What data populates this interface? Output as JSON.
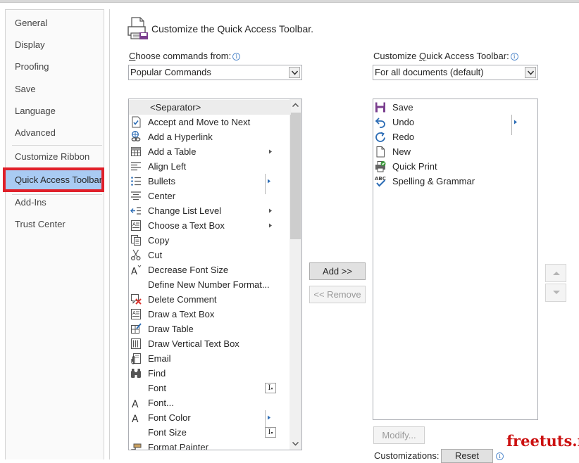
{
  "sidebar": {
    "items": [
      {
        "label": "General",
        "selected": false
      },
      {
        "label": "Display",
        "selected": false
      },
      {
        "label": "Proofing",
        "selected": false
      },
      {
        "label": "Save",
        "selected": false
      },
      {
        "label": "Language",
        "selected": false
      },
      {
        "label": "Advanced",
        "selected": false
      },
      {
        "label": "Customize Ribbon",
        "selected": false
      },
      {
        "label": "Quick Access Toolbar",
        "selected": true
      },
      {
        "label": "Add-Ins",
        "selected": false
      },
      {
        "label": "Trust Center",
        "selected": false
      }
    ]
  },
  "header": {
    "title": "Customize the Quick Access Toolbar.",
    "icon": "toolbar-printer-icon"
  },
  "choose": {
    "label": "Choose commands from:",
    "label_underline": "C",
    "label_rest": "hoose commands from:",
    "value": "Popular Commands"
  },
  "customize": {
    "label_pre": "Customize ",
    "label_underline": "Q",
    "label_post": "uick Access Toolbar:",
    "value": "For all documents (default)"
  },
  "commands": [
    {
      "label": "<Separator>",
      "icon": "separator",
      "separator": true
    },
    {
      "label": "Accept and Move to Next",
      "icon": "accept-icon"
    },
    {
      "label": "Add a Hyperlink",
      "icon": "hyperlink-icon"
    },
    {
      "label": "Add a Table",
      "icon": "table-icon",
      "submenu": "arrow"
    },
    {
      "label": "Align Left",
      "icon": "align-left-icon"
    },
    {
      "label": "Bullets",
      "icon": "bullets-icon",
      "submenu": "bar-arrow"
    },
    {
      "label": "Center",
      "icon": "center-icon"
    },
    {
      "label": "Change List Level",
      "icon": "list-level-icon",
      "submenu": "arrow"
    },
    {
      "label": "Choose a Text Box",
      "icon": "textbox-icon",
      "submenu": "arrow"
    },
    {
      "label": "Copy",
      "icon": "copy-icon"
    },
    {
      "label": "Cut",
      "icon": "scissors-icon"
    },
    {
      "label": "Decrease Font Size",
      "icon": "decrease-font-icon"
    },
    {
      "label": "Define New Number Format...",
      "icon": ""
    },
    {
      "label": "Delete Comment",
      "icon": "delete-comment-icon"
    },
    {
      "label": "Draw a Text Box",
      "icon": "draw-textbox-icon"
    },
    {
      "label": "Draw Table",
      "icon": "draw-table-icon"
    },
    {
      "label": "Draw Vertical Text Box",
      "icon": "vertical-textbox-icon"
    },
    {
      "label": "Email",
      "icon": "email-icon"
    },
    {
      "label": "Find",
      "icon": "binoculars-icon"
    },
    {
      "label": "Font",
      "icon": "",
      "submenu": "ibox"
    },
    {
      "label": "Font...",
      "icon": "font-a-icon"
    },
    {
      "label": "Font Color",
      "icon": "font-color-icon",
      "submenu": "bar-arrow"
    },
    {
      "label": "Font Size",
      "icon": "",
      "submenu": "ibox"
    },
    {
      "label": "Format Painter",
      "icon": "format-painter-icon"
    }
  ],
  "toolbar_items": [
    {
      "label": "Save",
      "icon": "save-icon"
    },
    {
      "label": "Undo",
      "icon": "undo-icon",
      "submenu": "bar-arrow"
    },
    {
      "label": "Redo",
      "icon": "redo-icon"
    },
    {
      "label": "New",
      "icon": "new-doc-icon"
    },
    {
      "label": "Quick Print",
      "icon": "quick-print-icon"
    },
    {
      "label": "Spelling & Grammar",
      "icon": "spelling-icon"
    }
  ],
  "buttons": {
    "add": "Add >>",
    "remove": "<< Remove",
    "modify": "Modify...",
    "customizations": "Customizations:",
    "reset": "Reset"
  },
  "watermark": "freetuts.net",
  "colors": {
    "selected_nav_bg": "#a9cbf3",
    "selected_nav_border": "#e0202a",
    "watermark": "#cc1111"
  }
}
